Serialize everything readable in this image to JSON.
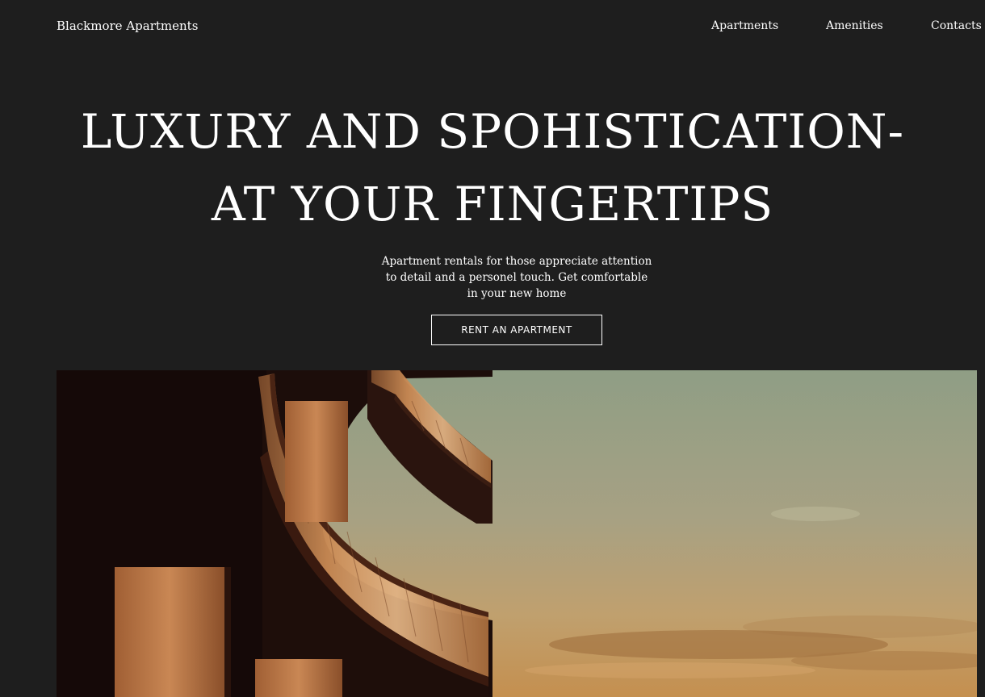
{
  "header": {
    "brand": "Blackmore Apartments",
    "nav": [
      "Apartments",
      "Amenities",
      "Contacts"
    ]
  },
  "hero": {
    "title_line1": "LUXURY AND SPOHISTICATION-",
    "title_line2": "AT YOUR FINGERTIPS",
    "subtitle": "Apartment rentals for those appreciate attention to detail and a personel touch. Get comfortable in your new home",
    "cta_label": "RENT AN APARTMENT"
  },
  "colors": {
    "background": "#1e1e1e",
    "text": "#ffffff",
    "accent_border": "#ffffff"
  }
}
